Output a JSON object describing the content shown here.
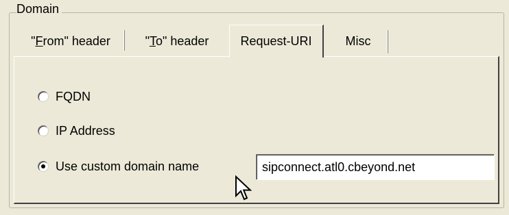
{
  "groupbox": {
    "label": "Domain"
  },
  "tabs": [
    {
      "label_prefix": "\"",
      "accel": "F",
      "label_suffix": "rom\" header"
    },
    {
      "label_prefix": "\"",
      "accel": "T",
      "label_suffix": "o\" header"
    },
    {
      "label": "Request-URI",
      "selected": true
    },
    {
      "label": "Misc"
    }
  ],
  "options": {
    "fqdn": {
      "label": "FQDN",
      "checked": false
    },
    "ip_address": {
      "label": "IP Address",
      "checked": false
    },
    "custom": {
      "label": "Use custom domain name",
      "checked": true
    }
  },
  "custom_domain": {
    "value": "sipconnect.atl0.cbeyond.net"
  },
  "cursor": {
    "icon": "mouse-pointer-icon"
  }
}
